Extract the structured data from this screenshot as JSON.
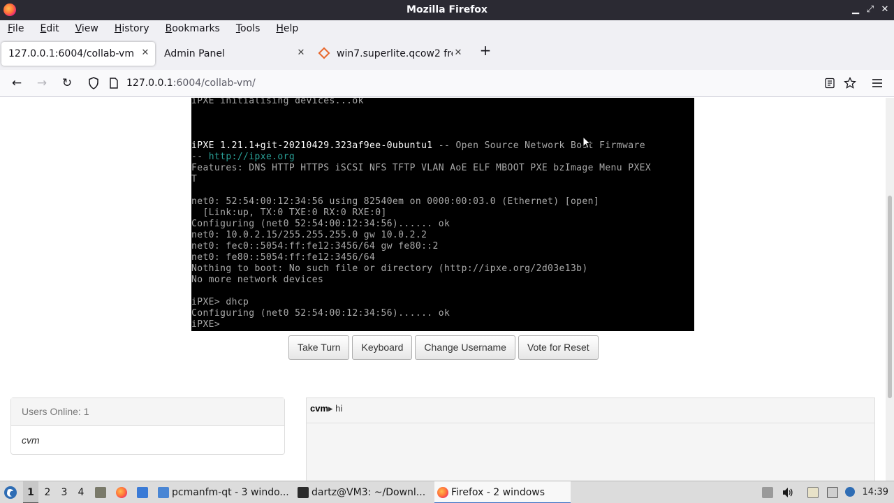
{
  "window": {
    "title": "Mozilla Firefox",
    "minimize": "▁",
    "maximize": "⤢",
    "close": "✕"
  },
  "menubar": {
    "items": [
      "File",
      "Edit",
      "View",
      "History",
      "Bookmarks",
      "Tools",
      "Help"
    ]
  },
  "tabs": [
    {
      "label": "127.0.0.1:6004/collab-vm/",
      "active": true
    },
    {
      "label": "Admin Panel",
      "active": false
    },
    {
      "label": "win7.superlite.qcow2 fre",
      "active": false
    }
  ],
  "tab_close": "✕",
  "new_tab": "+",
  "navbar": {
    "back": "←",
    "forward": "→",
    "reload": "↻",
    "url_host": "127.0.0.1",
    "url_rest": ":6004/collab-vm/"
  },
  "terminal": {
    "lines": [
      "iPXE initialising devices...ok",
      "",
      "",
      "",
      "Features: DNS HTTP HTTPS iSCSI NFS TFTP VLAN AoE ELF MBOOT PXE bzImage Menu PXEX",
      "T",
      "",
      "net0: 52:54:00:12:34:56 using 82540em on 0000:00:03.0 (Ethernet) [open]",
      "  [Link:up, TX:0 TXE:0 RX:0 RXE:0]",
      "Configuring (net0 52:54:00:12:34:56)...... ok",
      "net0: 10.0.2.15/255.255.255.0 gw 10.0.2.2",
      "net0: fec0::5054:ff:fe12:3456/64 gw fe80::2",
      "net0: fe80::5054:ff:fe12:3456/64",
      "Nothing to boot: No such file or directory (http://ipxe.org/2d03e13b)",
      "No more network devices",
      "",
      "iPXE> dhcp",
      "Configuring (net0 52:54:00:12:34:56)...... ok",
      "iPXE>"
    ],
    "banner_version": "iPXE 1.21.1+git-20210429.323af9ee-0ubuntu1",
    "banner_rest": " -- Open Source Network Boot Firmware",
    "banner_dash": "-- ",
    "banner_url": "http://ipxe.org"
  },
  "vm_buttons": [
    "Take Turn",
    "Keyboard",
    "Change Username",
    "Vote for Reset"
  ],
  "users": {
    "header": "Users Online: 1",
    "list": [
      "cvm"
    ]
  },
  "chat": {
    "username": "cvm",
    "arrow": "▸",
    "message": " hi"
  },
  "taskbar": {
    "workspaces": [
      "1",
      "2",
      "3",
      "4"
    ],
    "tasks": [
      {
        "label": "pcmanfm-qt - 3 windo...",
        "active": false
      },
      {
        "label": "dartz@VM3: ~/Downl...",
        "active": false
      },
      {
        "label": "Firefox - 2 windows",
        "active": true
      }
    ],
    "clock": "14:39"
  },
  "colors": {
    "titlebar": "#2b2a33",
    "accent": "#3b6fc4",
    "terminal_bg": "#000000"
  }
}
